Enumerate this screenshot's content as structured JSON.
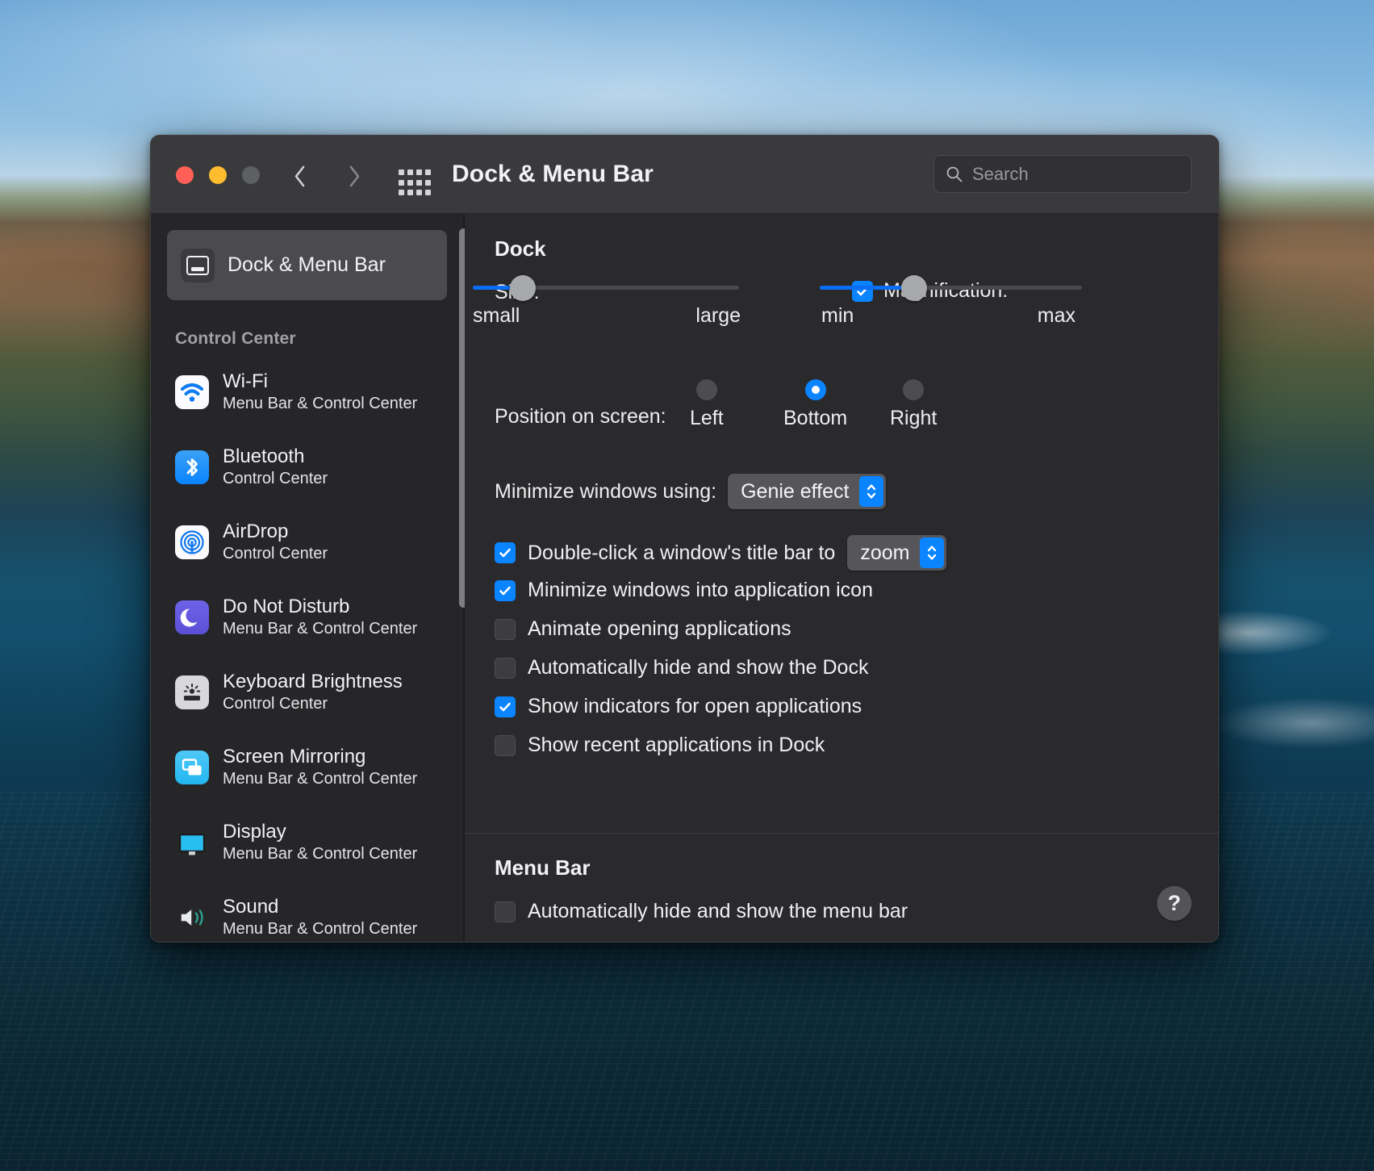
{
  "window": {
    "title": "Dock & Menu Bar",
    "traffic_lights": [
      "close",
      "minimize",
      "zoom"
    ],
    "nav_back": "back",
    "nav_forward": "forward",
    "grid_button": "show-all"
  },
  "search": {
    "placeholder": "Search",
    "value": ""
  },
  "sidebar": {
    "selected": {
      "label": "Dock & Menu Bar",
      "icon": "dock-icon"
    },
    "section_title": "Control Center",
    "items": [
      {
        "title": "Wi-Fi",
        "subtitle": "Menu Bar & Control Center",
        "icon": "wifi-icon"
      },
      {
        "title": "Bluetooth",
        "subtitle": "Control Center",
        "icon": "bluetooth-icon"
      },
      {
        "title": "AirDrop",
        "subtitle": "Control Center",
        "icon": "airdrop-icon"
      },
      {
        "title": "Do Not Disturb",
        "subtitle": "Menu Bar & Control Center",
        "icon": "moon-icon"
      },
      {
        "title": "Keyboard Brightness",
        "subtitle": "Control Center",
        "icon": "keyboard-brightness-icon"
      },
      {
        "title": "Screen Mirroring",
        "subtitle": "Menu Bar & Control Center",
        "icon": "screen-mirroring-icon"
      },
      {
        "title": "Display",
        "subtitle": "Menu Bar & Control Center",
        "icon": "display-icon"
      },
      {
        "title": "Sound",
        "subtitle": "Menu Bar & Control Center",
        "icon": "sound-icon"
      }
    ]
  },
  "dock": {
    "section_title": "Dock",
    "size_label": "Size:",
    "size_min_label": "small",
    "size_max_label": "large",
    "size_value": 18,
    "magnification_label": "Magnification:",
    "magnification_checked": true,
    "magnification_min_label": "min",
    "magnification_max_label": "max",
    "magnification_value": 35,
    "position_label": "Position on screen:",
    "position_options": [
      {
        "label": "Left",
        "selected": false
      },
      {
        "label": "Bottom",
        "selected": true
      },
      {
        "label": "Right",
        "selected": false
      }
    ],
    "minimize_label": "Minimize windows using:",
    "minimize_value": "Genie effect",
    "double_click_prefix": "Double-click a window's title bar to",
    "double_click_checked": true,
    "double_click_value": "zoom",
    "checkboxes": [
      {
        "label": "Minimize windows into application icon",
        "checked": true
      },
      {
        "label": "Animate opening applications",
        "checked": false
      },
      {
        "label": "Automatically hide and show the Dock",
        "checked": false
      },
      {
        "label": "Show indicators for open applications",
        "checked": true
      },
      {
        "label": "Show recent applications in Dock",
        "checked": false
      }
    ]
  },
  "menu_bar": {
    "section_title": "Menu Bar",
    "auto_hide_label": "Automatically hide and show the menu bar",
    "auto_hide_checked": false
  },
  "help": {
    "label": "?"
  },
  "colors": {
    "accent": "#0a84ff",
    "window_bg": "#2a2a2c",
    "sidebar_bg": "#262628",
    "titlebar_bg": "#3a3a3c",
    "close": "#ff5f57",
    "minimize": "#febc2e",
    "zoom": "#5d6063"
  }
}
